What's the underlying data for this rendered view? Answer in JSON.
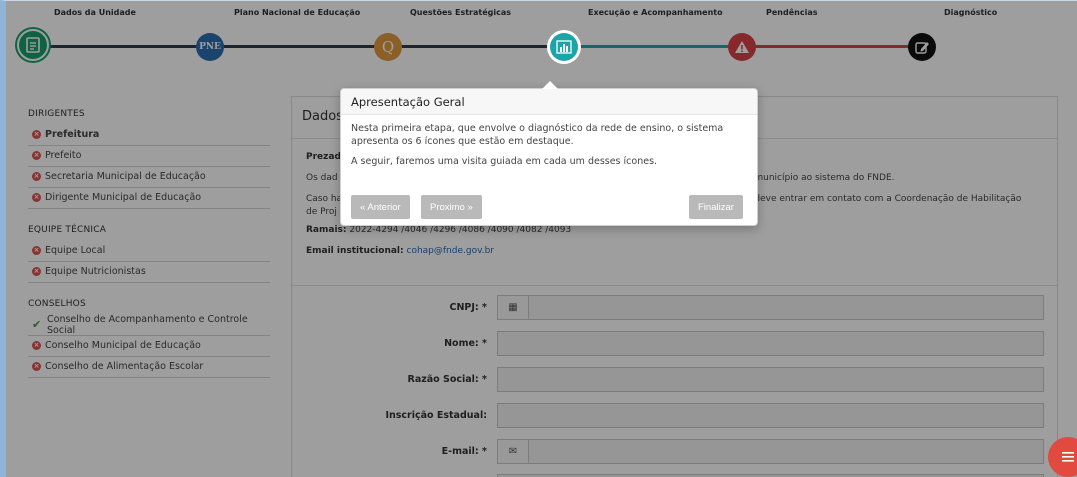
{
  "steps": [
    {
      "label": "Dados da Unidade",
      "icon": "document-icon",
      "color": "#1a9e6f"
    },
    {
      "label": "Plano Nacional de Educação",
      "icon_text": "PNE",
      "color": "#2b6cb0"
    },
    {
      "label": "Questões Estratégicas",
      "icon_text": "Q",
      "color": "#e09a3c"
    },
    {
      "label": "Execução e Acompanhamento",
      "icon": "bar-chart-icon",
      "color": "#1ba5a8"
    },
    {
      "label": "Pendências",
      "icon": "warning-icon",
      "color": "#d8434a"
    },
    {
      "label": "Diagnóstico",
      "icon": "edit-icon",
      "color": "#111111"
    }
  ],
  "sidebar": {
    "sections": [
      {
        "title": "DIRIGENTES",
        "items": [
          {
            "label": "Prefeitura",
            "status": "error",
            "bold": true
          },
          {
            "label": "Prefeito",
            "status": "error"
          },
          {
            "label": "Secretaria Municipal de Educação",
            "status": "error"
          },
          {
            "label": "Dirigente Municipal de Educação",
            "status": "error"
          }
        ]
      },
      {
        "title": "EQUIPE TÉCNICA",
        "items": [
          {
            "label": "Equipe Local",
            "status": "error"
          },
          {
            "label": "Equipe Nutricionistas",
            "status": "error"
          }
        ]
      },
      {
        "title": "CONSELHOS",
        "items": [
          {
            "label": "Conselho de Acompanhamento e Controle Social",
            "status": "ok"
          },
          {
            "label": "Conselho Municipal de Educação",
            "status": "error"
          },
          {
            "label": "Conselho de Alimentação Escolar",
            "status": "error"
          }
        ]
      }
    ]
  },
  "main": {
    "title": "Dados",
    "greeting": "Prezad",
    "line1_start": "Os dad",
    "line1_end": "o município ao sistema do FNDE.",
    "line2_start": "Caso ha",
    "line2_end": "o deve entrar em contato com a Coordenação de Habilitação",
    "line2_cont": "de Proj",
    "ramais_label": "Ramais:",
    "ramais_value": "2022-4294 /4046 /4296 /4086 /4090 /4082 /4093",
    "email_label": "Email institucional:",
    "email_value": "cohap@fnde.gov.br",
    "form": [
      {
        "label": "CNPJ: *",
        "addon": "building-icon"
      },
      {
        "label": "Nome: *"
      },
      {
        "label": "Razão Social: *"
      },
      {
        "label": "Inscrição Estadual:"
      },
      {
        "label": "E-mail: *",
        "addon": "envelope-icon"
      }
    ]
  },
  "popover": {
    "title": "Apresentação Geral",
    "text1": "Nesta primeira etapa, que envolve o diagnóstico da rede de ensino, o sistema apresenta os 6 ícones que estão em destaque.",
    "text2": "A seguir, faremos uma visita guiada em cada um desses ícones.",
    "prev": "« Anterior",
    "next": "Proximo »",
    "finish": "Finalizar"
  },
  "colors": {
    "overlay": "rgba(0,0,0,0.38)",
    "fab": "#e04a3f",
    "error": "#d9534f",
    "ok": "#3c9a35"
  }
}
